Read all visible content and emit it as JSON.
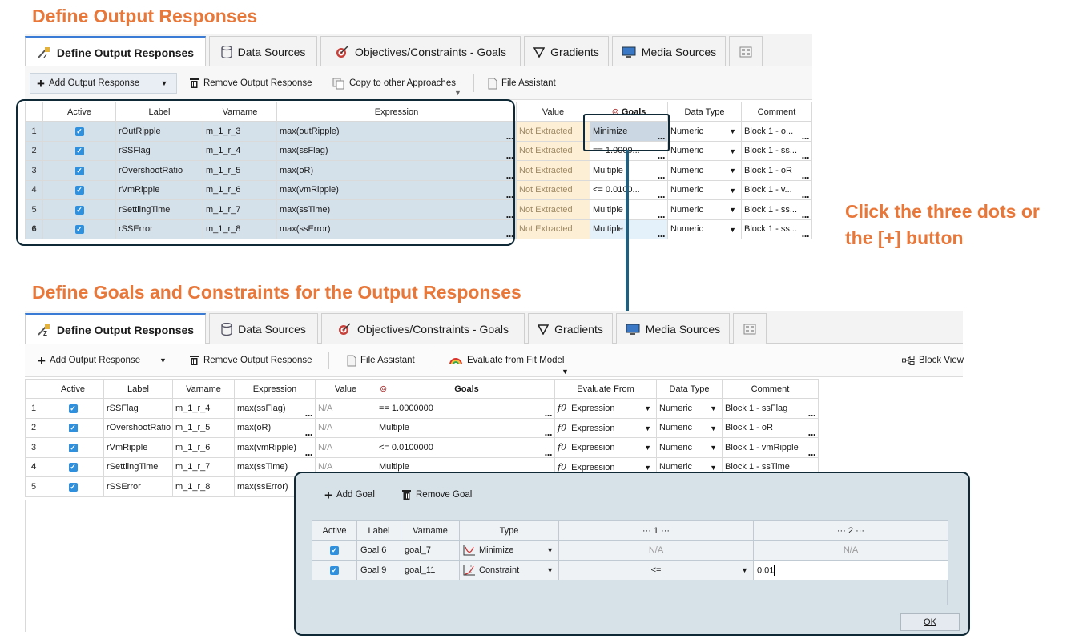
{
  "heading1": "Define Output Responses",
  "heading2": "Define Goals and Constraints for the Output Responses",
  "annotation": {
    "line1": "Click the three dots or",
    "line2": "the [+] button"
  },
  "tabs": [
    "Define Output Responses",
    "Data Sources",
    "Objectives/Constraints - Goals",
    "Gradients",
    "Media Sources"
  ],
  "top": {
    "toolbar": {
      "add": "Add Output Response",
      "remove": "Remove Output Response",
      "copy": "Copy to other Approaches",
      "file": "File Assistant"
    },
    "columns": [
      "Active",
      "Label",
      "Varname",
      "Expression",
      "Value",
      "Goals",
      "Data Type",
      "Comment"
    ],
    "rows": [
      {
        "n": "1",
        "label": "rOutRipple",
        "var": "m_1_r_3",
        "expr": "max(outRipple)",
        "value": "Not Extracted",
        "goal": "Minimize",
        "dtype": "Numeric",
        "comment": "Block 1 - o..."
      },
      {
        "n": "2",
        "label": "rSSFlag",
        "var": "m_1_r_4",
        "expr": "max(ssFlag)",
        "value": "Not Extracted",
        "goal": "== 1.0000...",
        "dtype": "Numeric",
        "comment": "Block 1 - ss..."
      },
      {
        "n": "3",
        "label": "rOvershootRatio",
        "var": "m_1_r_5",
        "expr": "max(oR)",
        "value": "Not Extracted",
        "goal": "Multiple",
        "dtype": "Numeric",
        "comment": "Block 1 - oR"
      },
      {
        "n": "4",
        "label": "rVmRipple",
        "var": "m_1_r_6",
        "expr": "max(vmRipple)",
        "value": "Not Extracted",
        "goal": "<= 0.0100...",
        "dtype": "Numeric",
        "comment": "Block 1 - v..."
      },
      {
        "n": "5",
        "label": "rSettlingTime",
        "var": "m_1_r_7",
        "expr": "max(ssTime)",
        "value": "Not Extracted",
        "goal": "Multiple",
        "dtype": "Numeric",
        "comment": "Block 1 - ss..."
      },
      {
        "n": "6",
        "label": "rSSError",
        "var": "m_1_r_8",
        "expr": "max(ssError)",
        "value": "Not Extracted",
        "goal": "Multiple",
        "dtype": "Numeric",
        "comment": "Block 1 - ss..."
      }
    ]
  },
  "bottom": {
    "toolbar": {
      "add": "Add Output Response",
      "remove": "Remove Output Response",
      "file": "File Assistant",
      "evaluate": "Evaluate from Fit Model",
      "block_view": "Block View"
    },
    "columns": [
      "Active",
      "Label",
      "Varname",
      "Expression",
      "Value",
      "Goals",
      "Evaluate From",
      "Data Type",
      "Comment"
    ],
    "rows": [
      {
        "n": "1",
        "label": "rSSFlag",
        "var": "m_1_r_4",
        "expr": "max(ssFlag)",
        "value": "N/A",
        "goal": "== 1.0000000",
        "eval": "Expression",
        "dtype": "Numeric",
        "comment": "Block 1 - ssFlag"
      },
      {
        "n": "2",
        "label": "rOvershootRatio",
        "var": "m_1_r_5",
        "expr": "max(oR)",
        "value": "N/A",
        "goal": "Multiple",
        "eval": "Expression",
        "dtype": "Numeric",
        "comment": "Block 1 - oR"
      },
      {
        "n": "3",
        "label": "rVmRipple",
        "var": "m_1_r_6",
        "expr": "max(vmRipple)",
        "value": "N/A",
        "goal": "<= 0.0100000",
        "eval": "Expression",
        "dtype": "Numeric",
        "comment": "Block 1 - vmRipple"
      },
      {
        "n": "4",
        "label": "rSettlingTime",
        "var": "m_1_r_7",
        "expr": "max(ssTime)",
        "value": "N/A",
        "goal": "Multiple",
        "eval": "Expression",
        "dtype": "Numeric",
        "comment": "Block 1 - ssTime"
      },
      {
        "n": "5",
        "label": "rSSError",
        "var": "m_1_r_8",
        "expr": "max(ssError)"
      }
    ]
  },
  "dialog": {
    "add": "Add Goal",
    "remove": "Remove Goal",
    "columns": [
      "Active",
      "Label",
      "Varname",
      "Type",
      "··· 1 ···",
      "··· 2 ···"
    ],
    "rows": [
      {
        "label": "Goal 6",
        "var": "goal_7",
        "type": "Minimize",
        "c1": "N/A",
        "c2": "N/A"
      },
      {
        "label": "Goal 9",
        "var": "goal_11",
        "type": "Constraint",
        "c1": "<=",
        "c2": "0.01"
      }
    ],
    "ok": "OK"
  },
  "colors": {
    "accent_orange": "#e8773a",
    "highlight_navy": "#0f2a36",
    "checkbox_blue": "#2f91de",
    "arrow": "#1f5f80"
  }
}
